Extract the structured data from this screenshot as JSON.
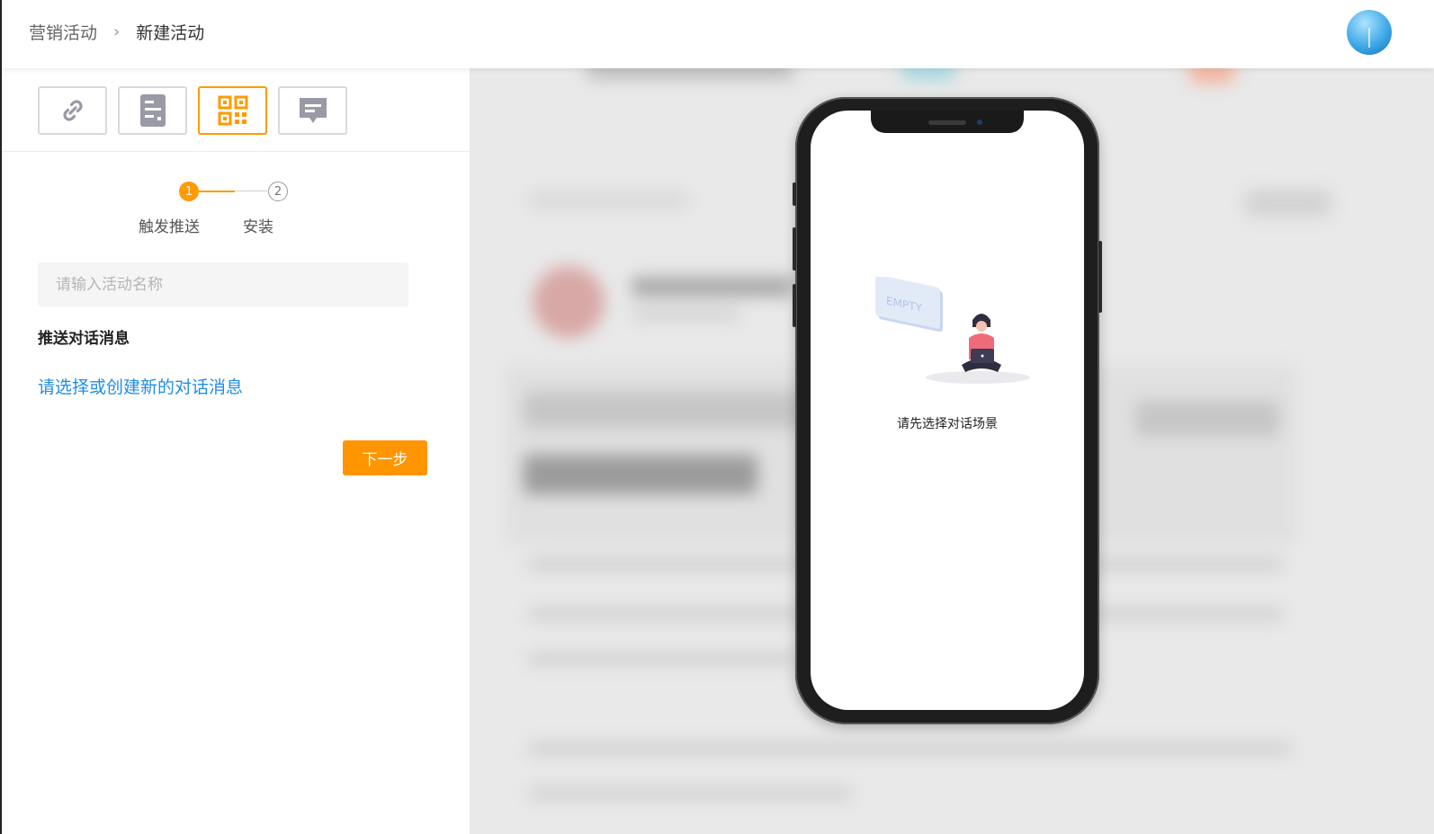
{
  "breadcrumb": {
    "root": "营销活动",
    "separator": "›",
    "current": "新建活动"
  },
  "header": {
    "avatar_icon": "user-avatar"
  },
  "type_tabs": [
    {
      "icon": "link-icon",
      "active": false
    },
    {
      "icon": "server-icon",
      "active": false
    },
    {
      "icon": "qrcode-icon",
      "active": true
    },
    {
      "icon": "message-icon",
      "active": false
    }
  ],
  "steps": [
    {
      "number": "1",
      "label": "触发推送",
      "active": true
    },
    {
      "number": "2",
      "label": "安装",
      "active": false
    }
  ],
  "form": {
    "name_placeholder": "请输入活动名称",
    "name_value": "",
    "section_title": "推送对话消息",
    "select_link": "请选择或创建新的对话消息",
    "next_button": "下一步"
  },
  "preview": {
    "empty_badge": "EMPTY",
    "empty_message": "请先选择对话场景"
  },
  "colors": {
    "accent": "#ff9a00",
    "link": "#1f8de6",
    "active_border": "#ff9a00"
  }
}
